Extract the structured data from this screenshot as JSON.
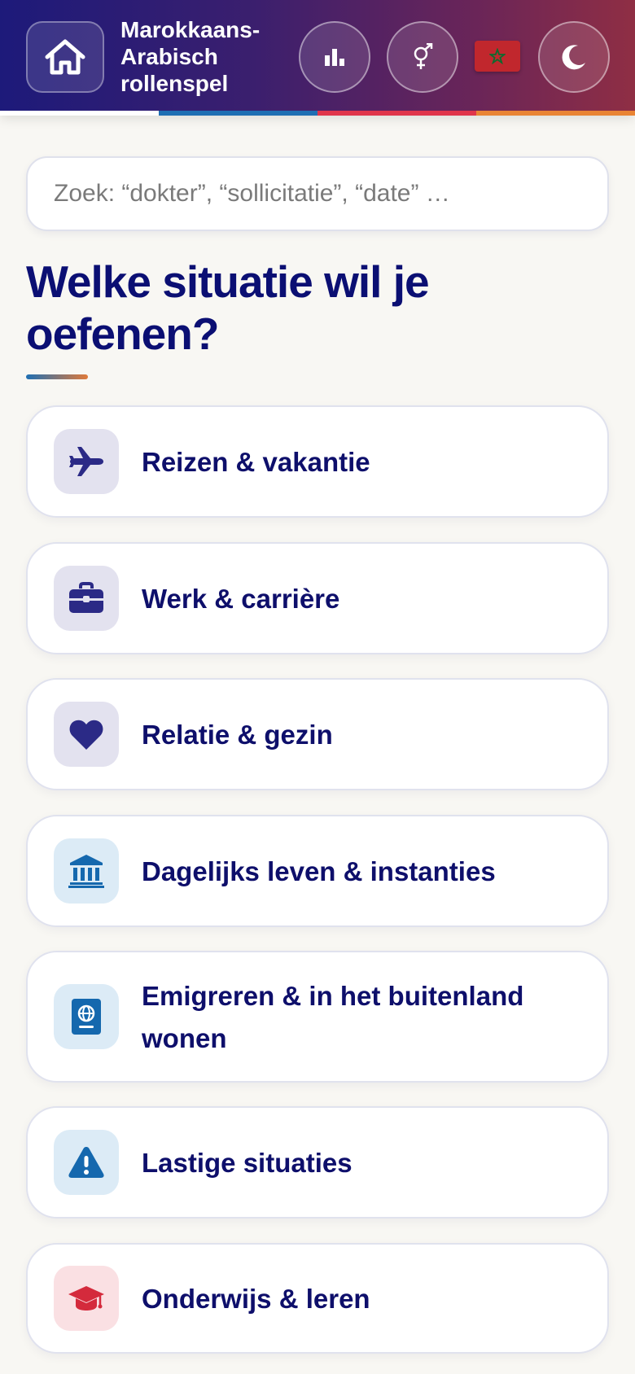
{
  "header": {
    "title": "Marokkaans-Arabisch rollenspel",
    "stripe_colors": [
      "#ffffff",
      "#1f6fb3",
      "#e0354b",
      "#e98434"
    ]
  },
  "search": {
    "placeholder": "Zoek: “dokter”, “sollicitatie”, “date” …"
  },
  "main": {
    "heading": "Welke situatie wil je oefenen?"
  },
  "categories": [
    {
      "label": "Reizen & vakantie",
      "icon": "airplane-icon",
      "icon_bg": "#e3e2ef",
      "icon_color": "#2b2a86"
    },
    {
      "label": "Werk & carrière",
      "icon": "briefcase-icon",
      "icon_bg": "#e3e2ef",
      "icon_color": "#2b2a86"
    },
    {
      "label": "Relatie & gezin",
      "icon": "heart-icon",
      "icon_bg": "#e3e2ef",
      "icon_color": "#2b2a86"
    },
    {
      "label": "Dagelijks leven & instanties",
      "icon": "bank-icon",
      "icon_bg": "#dcebf6",
      "icon_color": "#1568ae"
    },
    {
      "label": "Emigreren & in het buitenland wonen",
      "icon": "passport-icon",
      "icon_bg": "#dcebf6",
      "icon_color": "#1568ae"
    },
    {
      "label": "Lastige situaties",
      "icon": "warning-icon",
      "icon_bg": "#dcebf6",
      "icon_color": "#1568ae"
    },
    {
      "label": "Onderwijs & leren",
      "icon": "graduation-cap-icon",
      "icon_bg": "#fae0e3",
      "icon_color": "#d42a3c"
    }
  ]
}
